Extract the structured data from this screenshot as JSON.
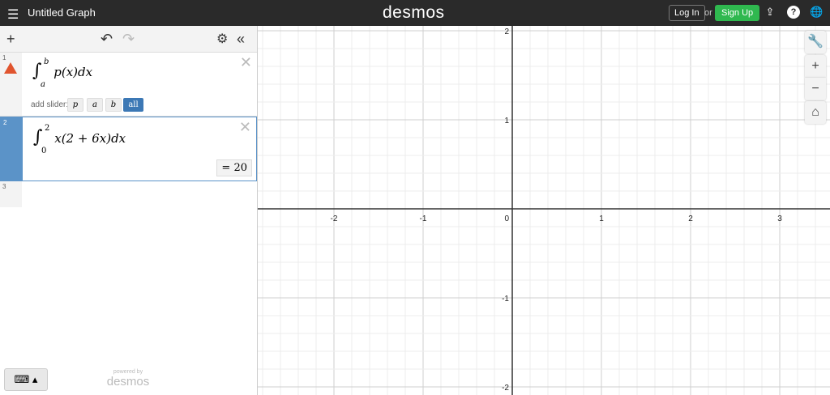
{
  "header": {
    "menu_icon": "hamburger-icon",
    "title": "Untitled Graph",
    "logo": "desmos",
    "login": "Log In",
    "or": "or",
    "signup": "Sign Up"
  },
  "toolbar": {
    "add": "+",
    "undo": "↶",
    "redo": "↷",
    "settings": "⚙",
    "collapse": "«"
  },
  "expressions": [
    {
      "index": "1",
      "integral": "∫",
      "upper": "b",
      "lower": "a",
      "body": "p(x)dx",
      "warning": true,
      "slider_label": "add slider:",
      "sliders": [
        "p",
        "a",
        "b",
        "all"
      ]
    },
    {
      "index": "2",
      "integral": "∫",
      "upper": "2",
      "lower": "0",
      "body": "x(2 + 6x)dx",
      "result": "= 20"
    },
    {
      "index": "3"
    }
  ],
  "footer": {
    "keyboard": "⌨ ▴",
    "powered_by": "powered by",
    "brand": "desmos"
  },
  "graph": {
    "x_ticks": [
      "-2",
      "-1",
      "0",
      "1",
      "2",
      "3"
    ],
    "y_ticks": [
      "2",
      "1",
      "-1",
      "-2"
    ],
    "accent": "#2f72b3"
  }
}
